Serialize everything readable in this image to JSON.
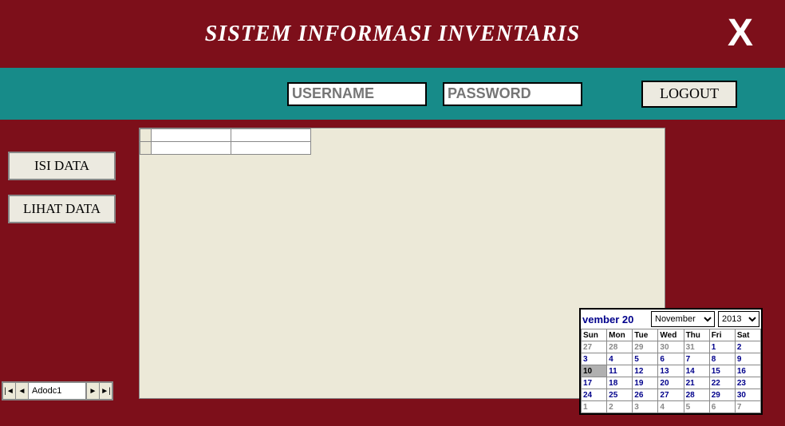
{
  "header": {
    "title": "SISTEM INFORMASI INVENTARIS",
    "close": "X"
  },
  "toolbar": {
    "username_placeholder": "USERNAME",
    "password_placeholder": "PASSWORD",
    "logout_label": "LOGOUT"
  },
  "sidebar": {
    "isi_data": "ISI DATA",
    "lihat_data": "LIHAT DATA"
  },
  "adodc": {
    "label": "Adodc1"
  },
  "calendar": {
    "title_partial": "vember 20",
    "month_selected": "November",
    "year_selected": "2013",
    "day_headers": [
      "Sun",
      "Mon",
      "Tue",
      "Wed",
      "Thu",
      "Fri",
      "Sat"
    ],
    "weeks": [
      [
        {
          "d": "27",
          "o": true
        },
        {
          "d": "28",
          "o": true
        },
        {
          "d": "29",
          "o": true
        },
        {
          "d": "30",
          "o": true
        },
        {
          "d": "31",
          "o": true
        },
        {
          "d": "1"
        },
        {
          "d": "2"
        }
      ],
      [
        {
          "d": "3"
        },
        {
          "d": "4"
        },
        {
          "d": "5"
        },
        {
          "d": "6"
        },
        {
          "d": "7"
        },
        {
          "d": "8"
        },
        {
          "d": "9"
        }
      ],
      [
        {
          "d": "10",
          "t": true
        },
        {
          "d": "11"
        },
        {
          "d": "12"
        },
        {
          "d": "13"
        },
        {
          "d": "14"
        },
        {
          "d": "15"
        },
        {
          "d": "16"
        }
      ],
      [
        {
          "d": "17"
        },
        {
          "d": "18"
        },
        {
          "d": "19"
        },
        {
          "d": "20"
        },
        {
          "d": "21"
        },
        {
          "d": "22"
        },
        {
          "d": "23"
        }
      ],
      [
        {
          "d": "24"
        },
        {
          "d": "25"
        },
        {
          "d": "26"
        },
        {
          "d": "27"
        },
        {
          "d": "28"
        },
        {
          "d": "29"
        },
        {
          "d": "30"
        }
      ],
      [
        {
          "d": "1",
          "o": true
        },
        {
          "d": "2",
          "o": true
        },
        {
          "d": "3",
          "o": true
        },
        {
          "d": "4",
          "o": true
        },
        {
          "d": "5",
          "o": true
        },
        {
          "d": "6",
          "o": true
        },
        {
          "d": "7",
          "o": true
        }
      ]
    ]
  }
}
